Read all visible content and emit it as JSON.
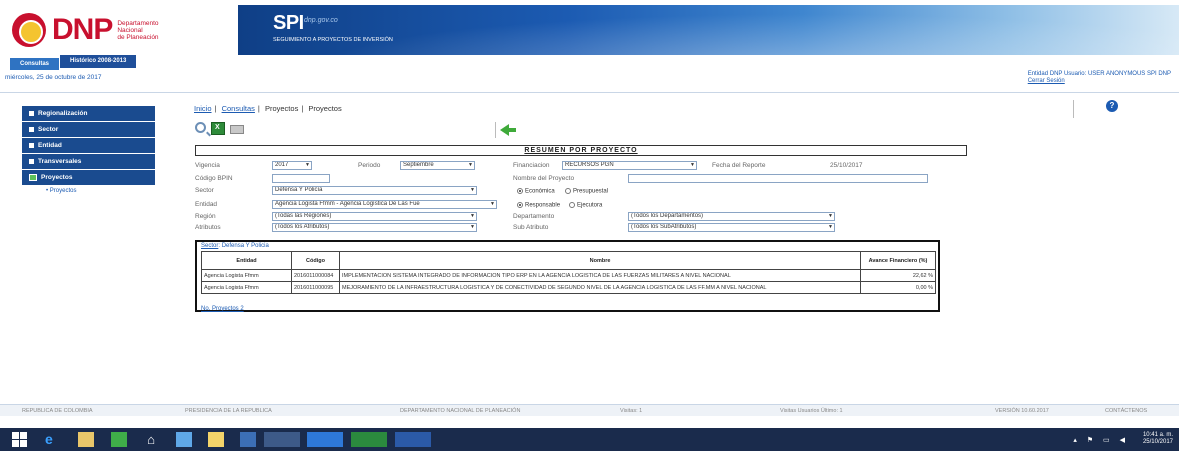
{
  "header": {
    "logo_text": "DNP",
    "logo_sub": [
      "Departamento",
      "Nacional",
      "de Planeación"
    ],
    "app_name": "SPI",
    "app_tag": "dnp.gov.co",
    "app_subtitle": "SEGUIMIENTO A PROYECTOS DE INVERSIÓN"
  },
  "tabs": [
    {
      "label": "Consultas"
    },
    {
      "label": "Histórico 2008-2013"
    }
  ],
  "date_line": "miércoles, 25 de octubre de 2017",
  "user": {
    "info": "Entidad DNP Usuario: USER ANONYMOUS SPI DNP",
    "logout": "Cerrar Sesión"
  },
  "sidebar": {
    "items": [
      {
        "label": "Regionalización"
      },
      {
        "label": "Sector"
      },
      {
        "label": "Entidad"
      },
      {
        "label": "Transversales"
      },
      {
        "label": "Proyectos"
      }
    ],
    "sub": "Proyectos"
  },
  "breadcrumb": {
    "items": [
      "Inicio",
      "Consultas",
      "Proyectos",
      "Proyectos"
    ]
  },
  "help_icon": "?",
  "title": "RESUMEN POR PROYECTO",
  "form": {
    "vigencia_label": "Vigencia",
    "vigencia_value": "2017",
    "periodo_label": "Periodo",
    "periodo_value": "Septiembre",
    "financiacion_label": "Financiacion",
    "financiacion_value": "RECURSOS PGN",
    "fecha_label": "Fecha del Reporte",
    "fecha_value": "25/10/2017",
    "codigo_label": "Código BPIN",
    "nombre_label": "Nombre del Proyecto",
    "sector_label": "Sector",
    "sector_value": "Defensa Y Policía",
    "radio_economica": "Económica",
    "radio_presupuestal": "Presupuestal",
    "entidad_label": "Entidad",
    "entidad_value": "Agencia Logista Ffmm - Agencia Logística De Las Fue",
    "radio_responsable": "Responsable",
    "radio_ejecutora": "Ejecutora",
    "region_label": "Región",
    "region_value": "(Todas las Regiones)",
    "departamento_label": "Departamento",
    "departamento_value": "(Todos los Departamentos)",
    "atributos_label": "Atributos",
    "atributos_value": "(Todos los Atributos)",
    "subatributo_label": "Sub Atributo",
    "subatributo_value": "(Todos los SubAtributos)"
  },
  "results": {
    "sector_link": "Sector",
    "sector_value": "Defensa Y Policia",
    "columns": [
      "Entidad",
      "Código",
      "Nombre",
      "Avance Financiero (%)"
    ],
    "rows": [
      {
        "entidad": "Agencia Logista Ffmm",
        "codigo": "2016011000084",
        "nombre": "IMPLEMENTACION SISTEMA INTEGRADO DE INFORMACION TIPO ERP EN LA AGENCIA LOGISTICA DE LAS FUERZAS MILITARES A NIVEL NACIONAL",
        "avance": "22,62 %"
      },
      {
        "entidad": "Agencia Logista Ffmm",
        "codigo": "2016011000095",
        "nombre": "MEJORAMIENTO DE LA INFRAESTRUCTURA LOGISTICA Y DE CONECTIVIDAD DE SEGUNDO NIVEL DE LA AGENCIA LOGISTICA DE LAS FF.MM A NIVEL NACIONAL",
        "avance": "0,00 %"
      }
    ],
    "footer": "No. Proyectos 2"
  },
  "footer": {
    "items": [
      "REPUBLICA DE COLOMBIA",
      "PRESIDENCIA DE LA REPUBLICA",
      "DEPARTAMENTO NACIONAL DE PLANEACIÓN",
      "Visitas: 1",
      "Visitas Usuarios Último: 1",
      "VERSIÓN 10.60.2017",
      "CONTÁCTENOS"
    ]
  },
  "taskbar": {
    "time": "10:41 a. m.",
    "date": "25/10/2017"
  }
}
